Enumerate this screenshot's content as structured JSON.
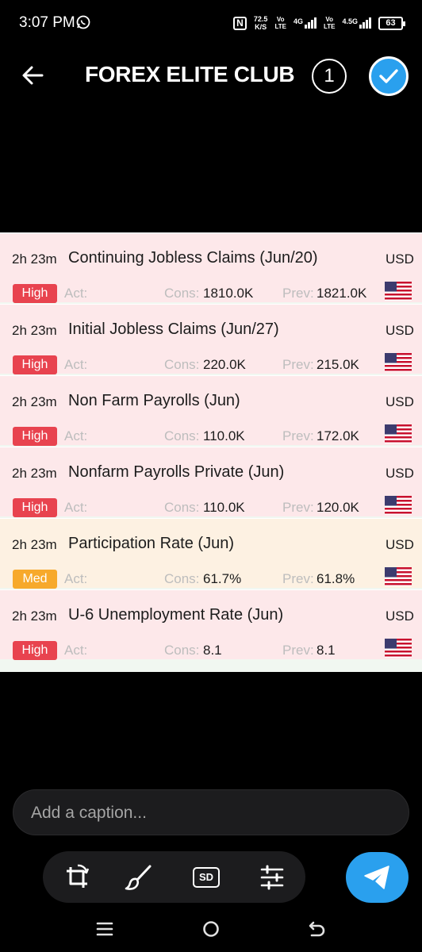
{
  "status_bar": {
    "time": "3:07 PM",
    "nfc": "N",
    "speed_value": "72.5",
    "speed_unit": "K/S",
    "volte_top": "Vo",
    "volte_bottom": "LTE",
    "net1": "4G",
    "net2": "4.5G",
    "battery": "63"
  },
  "header": {
    "title": "FOREX ELITE CLUB",
    "selected_count": "1"
  },
  "image_labels": {
    "act": "Act:",
    "cons": "Cons:",
    "prev": "Prev:"
  },
  "events": [
    {
      "time": "2h 23m",
      "name": "Continuing Jobless Claims (Jun/20)",
      "currency": "USD",
      "impact": "High",
      "cons": "1810.0K",
      "prev": "1821.0K"
    },
    {
      "time": "2h 23m",
      "name": "Initial Jobless Claims (Jun/27)",
      "currency": "USD",
      "impact": "High",
      "cons": "220.0K",
      "prev": "215.0K"
    },
    {
      "time": "2h 23m",
      "name": "Non Farm Payrolls (Jun)",
      "currency": "USD",
      "impact": "High",
      "cons": "110.0K",
      "prev": "172.0K"
    },
    {
      "time": "2h 23m",
      "name": "Nonfarm Payrolls Private (Jun)",
      "currency": "USD",
      "impact": "High",
      "cons": "110.0K",
      "prev": "120.0K"
    },
    {
      "time": "2h 23m",
      "name": "Participation Rate (Jun)",
      "currency": "USD",
      "impact": "Med",
      "cons": "61.7%",
      "prev": "61.8%"
    },
    {
      "time": "2h 23m",
      "name": "U-6 Unemployment Rate (Jun)",
      "currency": "USD",
      "impact": "High",
      "cons": "8.1",
      "prev": "8.1"
    }
  ],
  "caption": {
    "placeholder": "Add a caption..."
  },
  "tools": {
    "quality_label": "SD"
  },
  "icons": [
    "whatsapp-icon",
    "back-arrow-icon",
    "checkmark-icon",
    "us-flag-icon",
    "crop-rotate-icon",
    "brush-icon",
    "sliders-icon",
    "send-icon"
  ],
  "colors": {
    "accent": "#2aa0ee",
    "high_impact": "#e8434f",
    "med_impact": "#f7a92b",
    "high_row": "#fde8ea",
    "med_row": "#fdf1e2"
  }
}
